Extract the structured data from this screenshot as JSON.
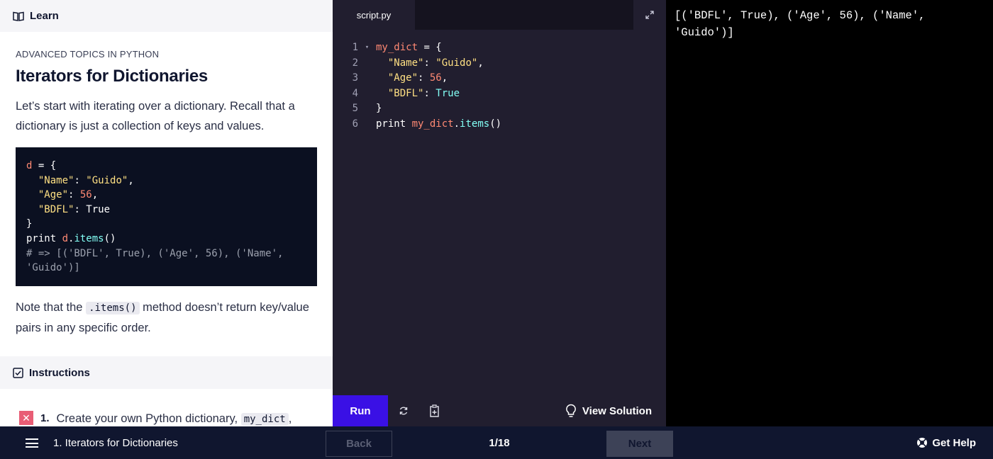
{
  "learn": {
    "header_label": "Learn",
    "kicker": "ADVANCED TOPICS IN PYTHON",
    "title": "Iterators for Dictionaries",
    "intro": "Let’s start with iterating over a dictionary. Recall that a dictionary is just a collection of keys and values.",
    "example_code": [
      [
        {
          "t": "d",
          "c": "var"
        },
        {
          "t": " = {",
          "c": "kw"
        }
      ],
      [
        {
          "t": "  ",
          "c": "kw"
        },
        {
          "t": "\"Name\"",
          "c": "str"
        },
        {
          "t": ": ",
          "c": "kw"
        },
        {
          "t": "\"Guido\"",
          "c": "str"
        },
        {
          "t": ",",
          "c": "kw"
        }
      ],
      [
        {
          "t": "  ",
          "c": "kw"
        },
        {
          "t": "\"Age\"",
          "c": "str"
        },
        {
          "t": ": ",
          "c": "kw"
        },
        {
          "t": "56",
          "c": "num"
        },
        {
          "t": ",",
          "c": "kw"
        }
      ],
      [
        {
          "t": "  ",
          "c": "kw"
        },
        {
          "t": "\"BDFL\"",
          "c": "str"
        },
        {
          "t": ": True",
          "c": "kw"
        }
      ],
      [
        {
          "t": "}",
          "c": "kw"
        }
      ],
      [
        {
          "t": "print ",
          "c": "kw"
        },
        {
          "t": "d",
          "c": "var"
        },
        {
          "t": ".",
          "c": "kw"
        },
        {
          "t": "items",
          "c": "fn"
        },
        {
          "t": "()",
          "c": "kw"
        }
      ],
      [
        {
          "t": "# => [('BDFL', True), ('Age', 56), ('Name',",
          "c": "com"
        }
      ],
      [
        {
          "t": "'Guido')]",
          "c": "com"
        }
      ]
    ],
    "note_before": "Note that the ",
    "note_code": ".items()",
    "note_after": " method doesn’t return key/value pairs in any specific order."
  },
  "instructions": {
    "header_label": "Instructions",
    "task_number": "1.",
    "task_text_before": "Create your own Python dictionary, ",
    "task_code": "my_dict",
    "task_text_after": ","
  },
  "editor": {
    "tab_label": "script.py",
    "lines": [
      {
        "n": "1",
        "fold": "▾",
        "tokens": [
          {
            "t": "my_dict",
            "c": "var"
          },
          {
            "t": " = {",
            "c": "kw"
          }
        ]
      },
      {
        "n": "2",
        "fold": "",
        "tokens": [
          {
            "t": "  ",
            "c": "kw"
          },
          {
            "t": "\"Name\"",
            "c": "str"
          },
          {
            "t": ": ",
            "c": "kw"
          },
          {
            "t": "\"Guido\"",
            "c": "str"
          },
          {
            "t": ",",
            "c": "kw"
          }
        ]
      },
      {
        "n": "3",
        "fold": "",
        "tokens": [
          {
            "t": "  ",
            "c": "kw"
          },
          {
            "t": "\"Age\"",
            "c": "str"
          },
          {
            "t": ": ",
            "c": "kw"
          },
          {
            "t": "56",
            "c": "num"
          },
          {
            "t": ",",
            "c": "kw"
          }
        ]
      },
      {
        "n": "4",
        "fold": "",
        "tokens": [
          {
            "t": "  ",
            "c": "kw"
          },
          {
            "t": "\"BDFL\"",
            "c": "str"
          },
          {
            "t": ": ",
            "c": "kw"
          },
          {
            "t": "True",
            "c": "fn"
          }
        ]
      },
      {
        "n": "5",
        "fold": "",
        "tokens": [
          {
            "t": "}",
            "c": "kw"
          }
        ]
      },
      {
        "n": "6",
        "fold": "",
        "tokens": [
          {
            "t": "print ",
            "c": "kw"
          },
          {
            "t": "my_dict",
            "c": "var"
          },
          {
            "t": ".",
            "c": "kw"
          },
          {
            "t": "items",
            "c": "fn"
          },
          {
            "t": "()",
            "c": "kw"
          }
        ]
      }
    ],
    "run_label": "Run",
    "view_solution_label": "View Solution"
  },
  "output": {
    "text": "[('BDFL', True), ('Age', 56), ('Name', 'Guido')]"
  },
  "footer": {
    "lesson_name": "1. Iterators for Dictionaries",
    "back_label": "Back",
    "progress": "1/18",
    "next_label": "Next",
    "help_label": "Get Help"
  },
  "colors": {
    "run_button": "#3a10e5",
    "footer_bg": "#10162f",
    "editor_bg": "#211e2f",
    "task_incomplete": "#e85d75"
  },
  "icons": [
    "book-icon",
    "expand-icon",
    "reset-icon",
    "copy-icon",
    "lightbulb-icon",
    "checkbox-icon",
    "menu-icon",
    "help-icon"
  ]
}
